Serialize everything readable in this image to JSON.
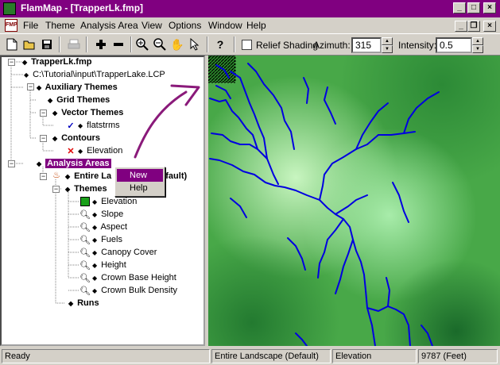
{
  "window": {
    "app_name": "FlamMap",
    "title": "FlamMap - [TrapperLk.fmp]"
  },
  "menu": {
    "doc_icon": "FMP",
    "items": [
      "File",
      "Theme",
      "Analysis Area",
      "View",
      "Options",
      "Window",
      "Help"
    ]
  },
  "toolbar": {
    "relief_label": "Relief Shading",
    "azimuth_label": "Azimuth:",
    "azimuth_value": "315",
    "intensity_label": "Intensity:",
    "intensity_value": "0.5"
  },
  "tree": {
    "root": "TrapperLk.fmp",
    "lcp_path": "C:\\Tutorial\\input\\TrapperLake.LCP",
    "auxiliary_themes": "Auxiliary Themes",
    "grid_themes": "Grid Themes",
    "vector_themes": "Vector Themes",
    "flatstrms": "flatstrms",
    "contours": "Contours",
    "elevation_contour": "Elevation",
    "analysis_areas": "Analysis Areas",
    "entire_landscape_a": "Entire La",
    "entire_landscape_b": "efault)",
    "themes": "Themes",
    "theme_items": [
      "Elevation",
      "Slope",
      "Aspect",
      "Fuels",
      "Canopy Cover",
      "Height",
      "Crown Base Height",
      "Crown Bulk Density"
    ],
    "runs": "Runs"
  },
  "context_menu": {
    "new": "New",
    "help": "Help"
  },
  "status": {
    "ready": "Ready",
    "area": "Entire Landscape (Default)",
    "theme": "Elevation",
    "value": "9787 (Feet)"
  },
  "colors": {
    "titlebar": "#800080",
    "selection": "#800080",
    "rivers": "#0000e0",
    "terrain_low": "#9ee69e",
    "terrain_high": "#1a6a2a"
  },
  "icons": [
    "app-icon",
    "new-file-icon",
    "open-folder-icon",
    "save-icon",
    "print-icon",
    "plus-icon",
    "minus-icon",
    "zoom-in-icon",
    "zoom-out-icon",
    "pan-hand-icon",
    "pointer-icon",
    "help-query-icon",
    "magnifier-icon",
    "fire-icon",
    "checkmark-icon",
    "x-icon"
  ]
}
